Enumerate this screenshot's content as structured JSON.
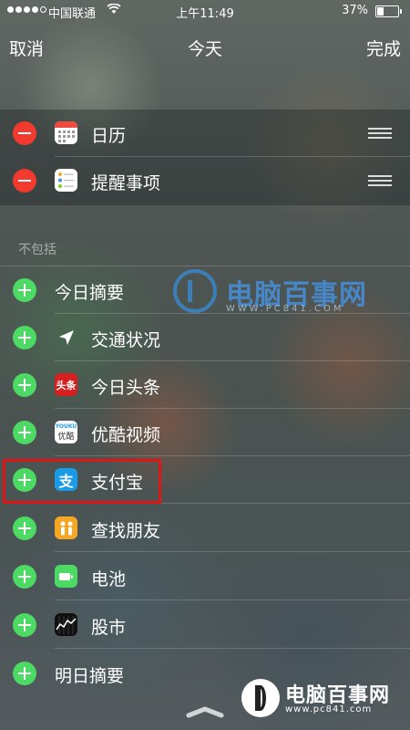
{
  "status_bar": {
    "carrier": "中国联通",
    "time": "上午11:49",
    "battery_percent": "37%",
    "battery_level": 0.37,
    "signal_bars_filled": 4,
    "signal_bars_total": 5
  },
  "nav": {
    "cancel_label": "取消",
    "title": "今天",
    "done_label": "完成"
  },
  "included_widgets": [
    {
      "label": "日历",
      "icon": "calendar-icon"
    },
    {
      "label": "提醒事项",
      "icon": "reminders-icon"
    }
  ],
  "excluded_section": {
    "header": "不包括",
    "items": [
      {
        "label": "今日摘要",
        "icon": ""
      },
      {
        "label": "交通状况",
        "icon": "location-arrow-icon"
      },
      {
        "label": "今日头条",
        "icon": "toutiao-icon",
        "icon_text": "头条"
      },
      {
        "label": "优酷视频",
        "icon": "youku-icon",
        "icon_text": "优酷"
      },
      {
        "label": "支付宝",
        "icon": "alipay-icon",
        "icon_text": "支"
      },
      {
        "label": "查找朋友",
        "icon": "find-friends-icon"
      },
      {
        "label": "电池",
        "icon": "battery-widget-icon"
      },
      {
        "label": "股市",
        "icon": "stocks-icon"
      },
      {
        "label": "明日摘要",
        "icon": ""
      }
    ]
  },
  "watermark": {
    "title": "电脑百事网",
    "subtitle": "WWW.PC841.COM"
  },
  "corner_logo": {
    "title": "电脑百事网",
    "subtitle": "www.pc841.com"
  },
  "colors": {
    "remove": "#f23a2f",
    "add": "#4cd964",
    "highlight": "#e01616",
    "alipay": "#1a9be8",
    "toutiao": "#d81e1e",
    "find_friends": "#f5a623",
    "battery_widget": "#4cd964"
  }
}
